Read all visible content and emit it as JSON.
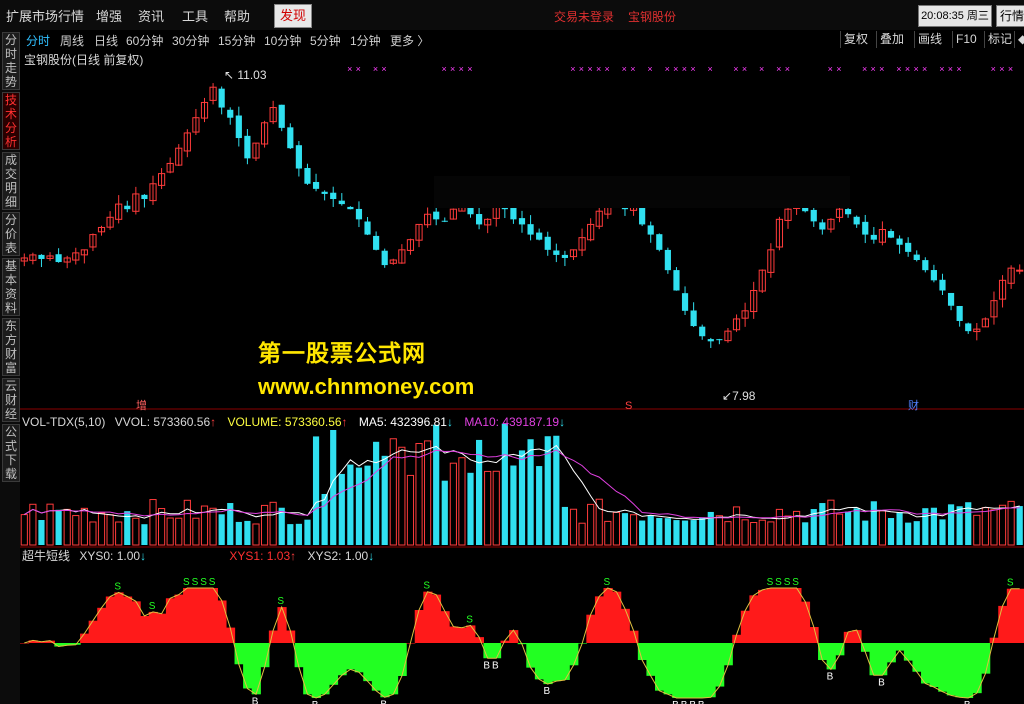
{
  "menubar": {
    "items": [
      "扩展市场行情",
      "增强",
      "资讯",
      "工具",
      "帮助"
    ],
    "discover": "发现",
    "status_trade": "交易未登录",
    "status_stock": "宝钢股份",
    "clock": "20:08:35 周三",
    "quote_tab": "行情"
  },
  "sidetabs": [
    "分时走势",
    "技术分析",
    "成交明细",
    "分价表",
    "基本资料",
    "东方财富",
    "云财经",
    "公式下载"
  ],
  "periodbar": {
    "periods": [
      "分时",
      "周线",
      "日线",
      "60分钟",
      "30分钟",
      "15分钟",
      "10分钟",
      "5分钟",
      "1分钟",
      "更多 〉"
    ],
    "tools": [
      "复权",
      "叠加",
      "画线",
      "F10",
      "标记",
      "◆"
    ]
  },
  "chart": {
    "title": "宝钢股份(日线 前复权)",
    "high_label": "11.03",
    "low_label": "7.98",
    "event_markers": [
      "增",
      "S",
      "财"
    ],
    "vol_indicator": {
      "name": "VOL-TDX(5,10)",
      "vvol": "VVOL: 573360.56",
      "volume": "VOLUME: 573360.56",
      "ma5": "MA5: 432396.81",
      "ma10": "MA10: 439187.19"
    },
    "osc_indicator": {
      "name": "超牛短线",
      "xys0": "XYS0: 1.00",
      "xys1": "XYS1: 1.03",
      "xys2": "XYS2: 1.00"
    },
    "signal_sell": "S",
    "signal_buy": "B"
  },
  "watermark": {
    "line1": "第一股票公式网",
    "line2": "www.chnmoney.com"
  },
  "colors": {
    "up": "#ff3b3b",
    "down": "#30e0f0",
    "ma5": "#ffffff",
    "ma10": "#e040e0",
    "osc_pos": "#ff1a1a",
    "osc_neg": "#22ff22",
    "marker": "#ff40ff"
  },
  "chart_data": {
    "type": "candlestick",
    "price_range": [
      7.98,
      11.03
    ],
    "close_path": [
      9.22,
      9.25,
      9.21,
      9.24,
      9.18,
      9.22,
      9.27,
      9.3,
      9.45,
      9.52,
      9.62,
      9.75,
      9.7,
      9.85,
      9.8,
      9.95,
      10.05,
      10.15,
      10.3,
      10.45,
      10.6,
      10.75,
      10.9,
      10.7,
      10.6,
      10.4,
      10.2,
      10.35,
      10.55,
      10.7,
      10.5,
      10.3,
      10.1,
      9.95,
      9.9,
      9.85,
      9.8,
      9.75,
      9.7,
      9.6,
      9.45,
      9.3,
      9.15,
      9.2,
      9.3,
      9.4,
      9.55,
      9.65,
      9.6,
      9.58,
      9.7,
      9.78,
      9.65,
      9.55,
      9.6,
      9.72,
      9.7,
      9.6,
      9.55,
      9.45,
      9.4,
      9.3,
      9.25,
      9.22,
      9.3,
      9.42,
      9.55,
      9.68,
      9.78,
      9.8,
      9.7,
      9.72,
      9.55,
      9.45,
      9.3,
      9.1,
      8.9,
      8.7,
      8.55,
      8.45,
      8.4,
      8.42,
      8.5,
      8.62,
      8.7,
      8.9,
      9.1,
      9.3,
      9.6,
      9.7,
      9.75,
      9.68,
      9.58,
      9.5,
      9.6,
      9.7,
      9.65,
      9.55,
      9.45,
      9.4,
      9.5,
      9.42,
      9.35,
      9.28,
      9.2,
      9.1,
      9.0,
      8.9,
      8.75,
      8.6,
      8.5,
      8.52,
      8.62,
      8.8,
      9.0,
      9.12,
      9.1
    ]
  }
}
